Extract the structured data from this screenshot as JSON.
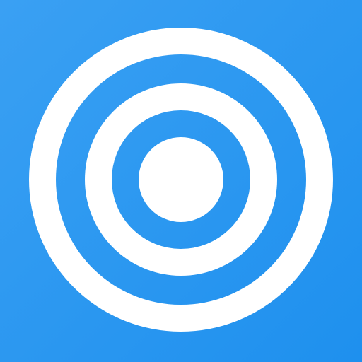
{
  "icon": {
    "name": "concentric-rings-icon",
    "colors": {
      "background_start": "#3aa0f3",
      "background_end": "#1e90ee",
      "ring": "#ffffff"
    }
  }
}
